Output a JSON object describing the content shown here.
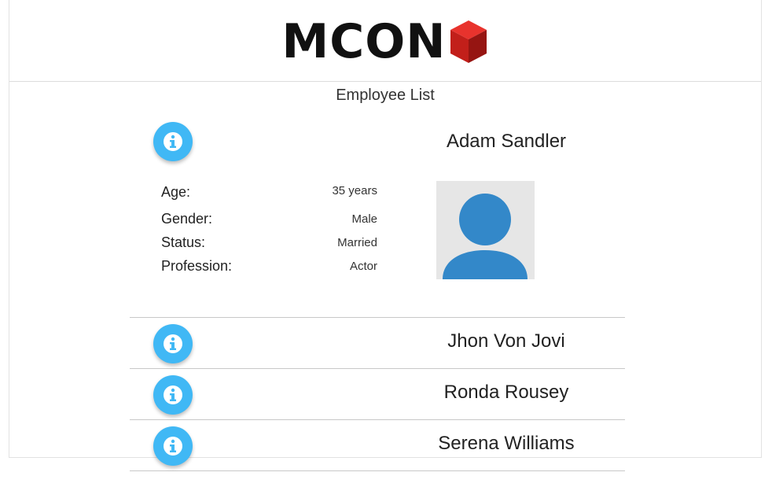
{
  "brand": {
    "logo_text": "MCON",
    "cube_colors": {
      "top": "#e8332d",
      "left": "#c21f1a",
      "right": "#961512"
    }
  },
  "page": {
    "title": "Employee List"
  },
  "colors": {
    "info_button": "#40b8f5",
    "avatar_bg": "#e6e6e6",
    "avatar_fg": "#3388c9"
  },
  "employees": [
    {
      "name": "Adam Sandler",
      "expanded": true,
      "details": [
        {
          "label": "Age:",
          "value": "35 years"
        },
        {
          "label": "Gender:",
          "value": "Male"
        },
        {
          "label": "Status:",
          "value": "Married"
        },
        {
          "label": "Profession:",
          "value": "Actor"
        }
      ],
      "avatar_icon": "user-avatar-icon"
    },
    {
      "name": "Jhon Von Jovi",
      "expanded": false
    },
    {
      "name": "Ronda Rousey",
      "expanded": false
    },
    {
      "name": "Serena Williams",
      "expanded": false
    }
  ],
  "icons": {
    "info": "info-circle-icon"
  }
}
